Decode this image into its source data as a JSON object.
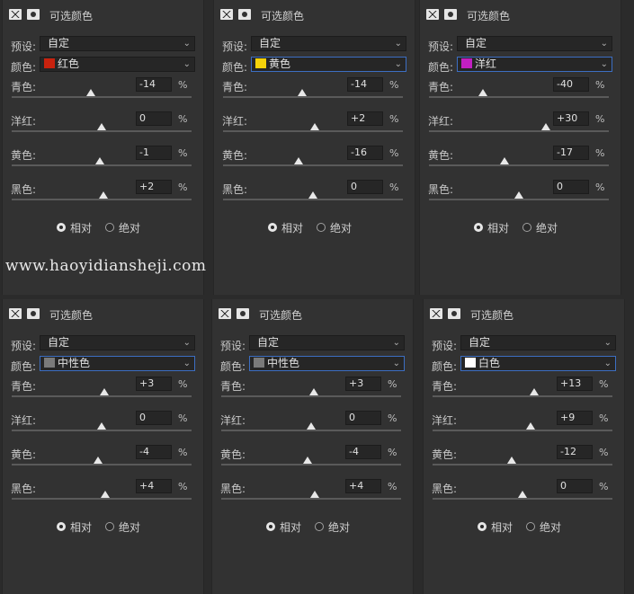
{
  "watermark": "www.haoyidiansheji.com",
  "labels": {
    "title": "可选颜色",
    "preset": "预设:",
    "color": "颜色:",
    "relative": "相对",
    "absolute": "绝对",
    "pct": "%"
  },
  "panels": [
    {
      "preset": "自定",
      "color_name": "红色",
      "swatch": "#c8220e",
      "active": false,
      "sliders": [
        {
          "label": "青色:",
          "value": "-14",
          "frac": 0.44
        },
        {
          "label": "洋红:",
          "value": "0",
          "frac": 0.5
        },
        {
          "label": "黄色:",
          "value": "-1",
          "frac": 0.49
        },
        {
          "label": "黑色:",
          "value": "+2",
          "frac": 0.51
        }
      ]
    },
    {
      "preset": "自定",
      "color_name": "黄色",
      "swatch": "#f5d20a",
      "active": true,
      "sliders": [
        {
          "label": "青色:",
          "value": "-14",
          "frac": 0.44
        },
        {
          "label": "洋红:",
          "value": "+2",
          "frac": 0.51
        },
        {
          "label": "黄色:",
          "value": "-16",
          "frac": 0.42
        },
        {
          "label": "黑色:",
          "value": "0",
          "frac": 0.5
        }
      ]
    },
    {
      "preset": "自定",
      "color_name": "洋红",
      "swatch": "#c21fc2",
      "active": true,
      "sliders": [
        {
          "label": "青色:",
          "value": "-40",
          "frac": 0.3
        },
        {
          "label": "洋红:",
          "value": "+30",
          "frac": 0.65
        },
        {
          "label": "黄色:",
          "value": "-17",
          "frac": 0.42
        },
        {
          "label": "黑色:",
          "value": "0",
          "frac": 0.5
        }
      ]
    },
    {
      "preset": "自定",
      "color_name": "中性色",
      "swatch": "#7a7a7a",
      "active": true,
      "sliders": [
        {
          "label": "青色:",
          "value": "+3",
          "frac": 0.515
        },
        {
          "label": "洋红:",
          "value": "0",
          "frac": 0.5
        },
        {
          "label": "黄色:",
          "value": "-4",
          "frac": 0.48
        },
        {
          "label": "黑色:",
          "value": "+4",
          "frac": 0.52
        }
      ]
    },
    {
      "preset": "自定",
      "color_name": "中性色",
      "swatch": "#7a7a7a",
      "active": true,
      "sliders": [
        {
          "label": "青色:",
          "value": "+3",
          "frac": 0.515
        },
        {
          "label": "洋红:",
          "value": "0",
          "frac": 0.5
        },
        {
          "label": "黄色:",
          "value": "-4",
          "frac": 0.48
        },
        {
          "label": "黑色:",
          "value": "+4",
          "frac": 0.52
        }
      ]
    },
    {
      "preset": "自定",
      "color_name": "白色",
      "swatch": "#ffffff",
      "active": true,
      "sliders": [
        {
          "label": "青色:",
          "value": "+13",
          "frac": 0.565
        },
        {
          "label": "洋红:",
          "value": "+9",
          "frac": 0.545
        },
        {
          "label": "黄色:",
          "value": "-12",
          "frac": 0.44
        },
        {
          "label": "黑色:",
          "value": "0",
          "frac": 0.5
        }
      ]
    }
  ]
}
